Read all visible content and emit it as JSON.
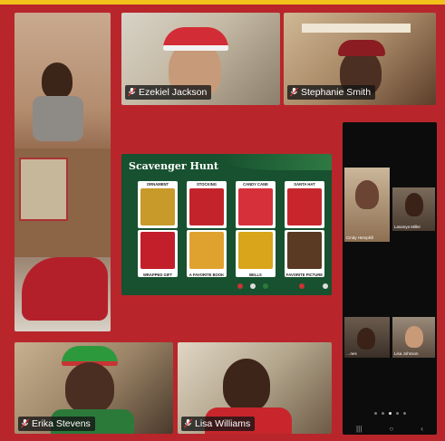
{
  "participants": {
    "ezekiel": "Ezekiel Jackson",
    "stephanie": "Stephanie Smith",
    "erika": "Erika Stevens",
    "lisa": "Lisa Williams"
  },
  "slide": {
    "title": "Scavenger Hunt",
    "items": [
      {
        "label": "ORNAMENT",
        "color": "#c79a2a"
      },
      {
        "label": "STOCKING",
        "color": "#c3242c"
      },
      {
        "label": "CANDY CANE",
        "color": "#d6303a"
      },
      {
        "label": "SANTA HAT",
        "color": "#c7262d"
      },
      {
        "label": "WRAPPED GIFT",
        "color": "#c21f2a"
      },
      {
        "label": "A FAVORITE BOOK",
        "color": "#e0a22f"
      },
      {
        "label": "BELLS",
        "color": "#d8a51b"
      },
      {
        "label": "FAVORITE PICTURE",
        "color": "#5a3a22"
      }
    ]
  },
  "phone_gallery": {
    "names": [
      "Cindy Hemphill",
      "Lasanya Miller",
      "…nes",
      "Lisa Johnson"
    ],
    "page_dots": 5,
    "active_dot": 2,
    "nav_icons": [
      "|||",
      "○",
      "‹"
    ]
  },
  "colors": {
    "background": "#b8262b",
    "top_accent": "#f2c21a",
    "slide_green": "#17512f"
  }
}
